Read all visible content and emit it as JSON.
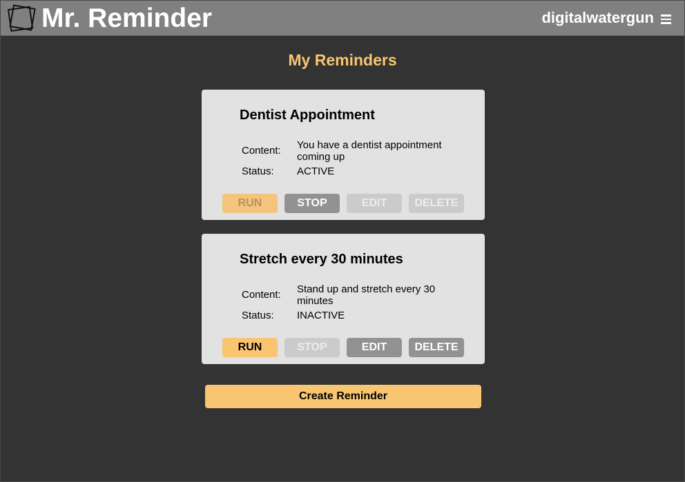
{
  "header": {
    "app_title": "Mr. Reminder",
    "username": "digitalwatergun",
    "logo_icon": "overlapping-squares-logo",
    "menu_icon": "hamburger-icon"
  },
  "page": {
    "title": "My Reminders"
  },
  "colors": {
    "accent": "#f9c571",
    "background": "#333333",
    "header": "#808080",
    "card": "#e2e2e2",
    "button_gray": "#929292",
    "button_disabled": "#cbcbcb"
  },
  "reminders": [
    {
      "title": "Dentist Appointment",
      "content_label": "Content:",
      "content": "You have a dentist appointment coming up",
      "status_label": "Status:",
      "status": "ACTIVE",
      "buttons": {
        "run": {
          "label": "RUN",
          "enabled": false
        },
        "stop": {
          "label": "STOP",
          "enabled": true
        },
        "edit": {
          "label": "EDIT",
          "enabled": false
        },
        "delete": {
          "label": "DELETE",
          "enabled": false
        }
      }
    },
    {
      "title": "Stretch every 30 minutes",
      "content_label": "Content:",
      "content": "Stand up and stretch every 30 minutes",
      "status_label": "Status:",
      "status": "INACTIVE",
      "buttons": {
        "run": {
          "label": "RUN",
          "enabled": true
        },
        "stop": {
          "label": "STOP",
          "enabled": false
        },
        "edit": {
          "label": "EDIT",
          "enabled": true
        },
        "delete": {
          "label": "DELETE",
          "enabled": true
        }
      }
    }
  ],
  "create_button": {
    "label": "Create Reminder"
  }
}
